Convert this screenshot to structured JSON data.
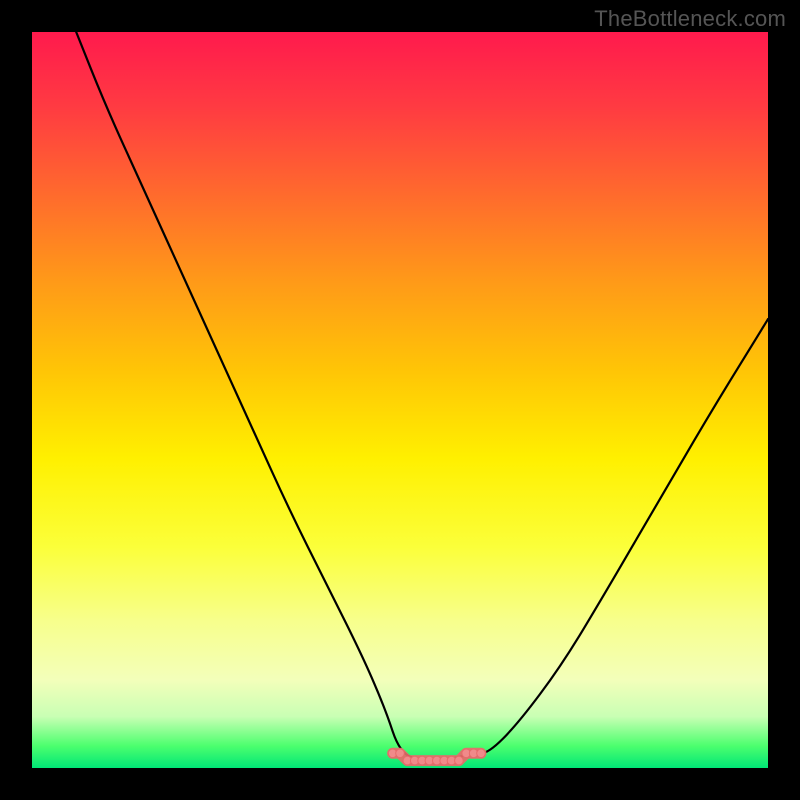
{
  "watermark": "TheBottleneck.com",
  "colors": {
    "frame": "#000000",
    "curve_stroke": "#000000",
    "marker_stroke": "#e86a6a",
    "marker_fill": "#f08a8a",
    "gradient_top": "#ff1a4d",
    "gradient_bottom": "#00e676"
  },
  "chart_data": {
    "type": "line",
    "title": "",
    "xlabel": "",
    "ylabel": "",
    "xlim": [
      0,
      100
    ],
    "ylim": [
      0,
      100
    ],
    "grid": false,
    "note": "Bottleneck-style V-curve; y ≈ mismatch percentage (0 at bottom, ~100 at top). x ≈ relative component capability. Values estimated from pixel positions.",
    "series": [
      {
        "name": "bottleneck-curve",
        "x": [
          6,
          10,
          15,
          20,
          25,
          30,
          35,
          40,
          45,
          48,
          50,
          53,
          56,
          60,
          62,
          66,
          72,
          78,
          85,
          92,
          100
        ],
        "values": [
          100,
          90,
          79,
          68,
          57,
          46,
          35,
          25,
          15,
          8,
          2,
          1,
          1,
          2,
          2,
          6,
          14,
          24,
          36,
          48,
          61
        ]
      }
    ],
    "annotations": [
      {
        "name": "flat-minimum-markers",
        "style": "dotted-red",
        "x": [
          49,
          50,
          51,
          52,
          53,
          54,
          55,
          56,
          57,
          58,
          59,
          60,
          61
        ],
        "values": [
          2,
          2,
          1,
          1,
          1,
          1,
          1,
          1,
          1,
          1,
          2,
          2,
          2
        ]
      }
    ]
  }
}
